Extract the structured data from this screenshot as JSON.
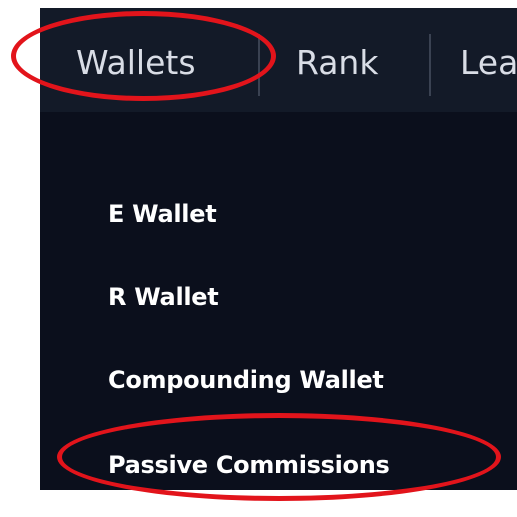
{
  "navbar": {
    "items": [
      {
        "label": "Wallets"
      },
      {
        "label": "Rank"
      },
      {
        "label": "Lea"
      }
    ]
  },
  "dropdown": {
    "items": [
      {
        "label": "E Wallet"
      },
      {
        "label": "R Wallet"
      },
      {
        "label": "Compounding Wallet"
      },
      {
        "label": "Passive Commissions"
      }
    ]
  },
  "colors": {
    "nav_background": "#131a28",
    "dropdown_background": "#0b0f1c",
    "annotation_red": "#e2141b",
    "text": "#ffffff"
  }
}
